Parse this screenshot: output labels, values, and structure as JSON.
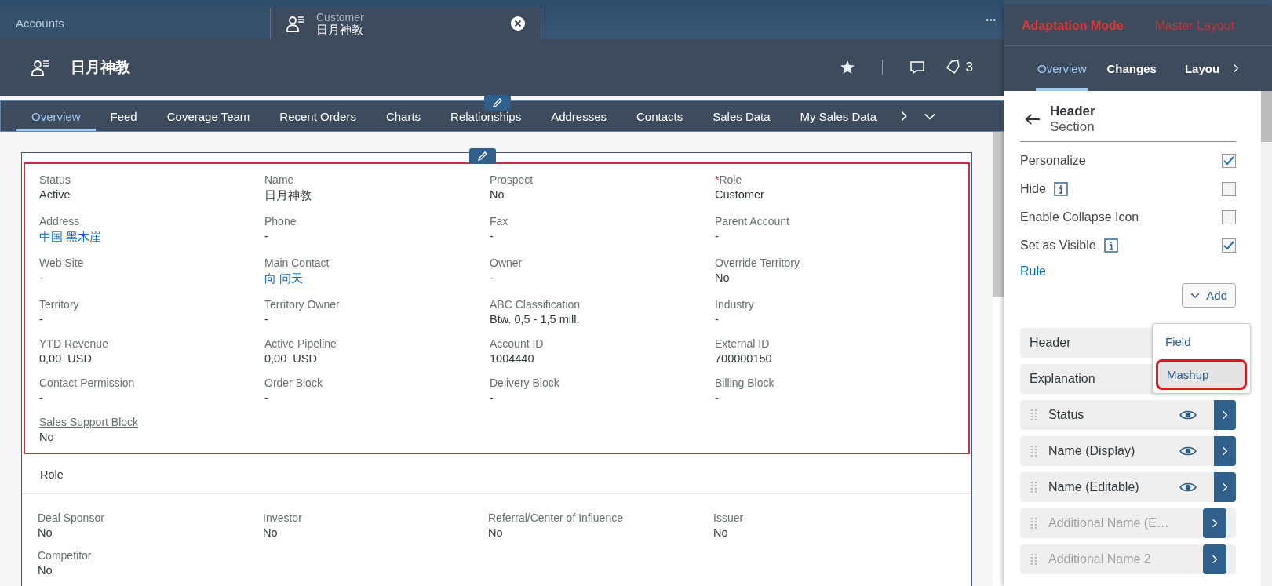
{
  "top_tabs": [
    {
      "label": "Accounts",
      "selected": false
    },
    {
      "title": "Customer",
      "label": "日月神教",
      "selected": true
    }
  ],
  "overflow": "•••",
  "header": {
    "title": "日月神教",
    "count": "3"
  },
  "nav_tabs": [
    {
      "label": "Overview",
      "selected": true
    },
    {
      "label": "Feed",
      "selected": false
    },
    {
      "label": "Coverage Team",
      "selected": false
    },
    {
      "label": "Recent Orders",
      "selected": false
    },
    {
      "label": "Charts",
      "selected": false
    },
    {
      "label": "Relationships",
      "selected": false
    },
    {
      "label": "Addresses",
      "selected": false
    },
    {
      "label": "Contacts",
      "selected": false
    },
    {
      "label": "Sales Data",
      "selected": false
    },
    {
      "label": "My Sales Data",
      "selected": false
    }
  ],
  "header_fields": [
    {
      "label": "Status",
      "underlined": false,
      "value": "Active",
      "link": false
    },
    {
      "label": "Name",
      "underlined": false,
      "value": "日月神教",
      "link": false
    },
    {
      "label": "Prospect",
      "underlined": false,
      "value": "No",
      "link": false
    },
    {
      "required_mark": "*",
      "label": "Role",
      "underlined": false,
      "value": "Customer",
      "link": false
    },
    {
      "label": "Address",
      "underlined": false,
      "value": "中国 黑木崖",
      "link": true
    },
    {
      "label": "Phone",
      "underlined": false,
      "value": "-",
      "link": false
    },
    {
      "label": "Fax",
      "underlined": false,
      "value": "-",
      "link": false
    },
    {
      "label": "Parent Account",
      "underlined": false,
      "value": "-",
      "link": false
    },
    {
      "label": "Web Site",
      "underlined": false,
      "value": "-",
      "link": false
    },
    {
      "label": "Main Contact",
      "underlined": false,
      "value": "向 问天",
      "link": true
    },
    {
      "label": "Owner",
      "underlined": false,
      "value": "-",
      "link": false
    },
    {
      "label": "Override Territory",
      "underlined": true,
      "value": "No",
      "link": false
    },
    {
      "label": "Territory",
      "underlined": false,
      "value": "-",
      "link": false
    },
    {
      "label": "Territory Owner",
      "underlined": false,
      "value": "-",
      "link": false
    },
    {
      "label": "ABC Classification",
      "underlined": false,
      "value": "Btw. 0,5 - 1,5 mill.",
      "link": false
    },
    {
      "label": "Industry",
      "underlined": false,
      "value": "-",
      "link": false
    },
    {
      "label": "YTD Revenue",
      "underlined": false,
      "value": "0,00  USD",
      "link": false
    },
    {
      "label": "Active Pipeline",
      "underlined": false,
      "value": "0,00  USD",
      "link": false
    },
    {
      "label": "Account ID",
      "underlined": false,
      "value": "1004440",
      "link": false
    },
    {
      "label": "External ID",
      "underlined": false,
      "value": "700000150",
      "link": false
    },
    {
      "label": "Contact Permission",
      "underlined": false,
      "value": "-",
      "link": false
    },
    {
      "label": "Order Block",
      "underlined": false,
      "value": "-",
      "link": false
    },
    {
      "label": "Delivery Block",
      "underlined": false,
      "value": "-",
      "link": false
    },
    {
      "label": "Billing Block",
      "underlined": false,
      "value": "-",
      "link": false
    },
    {
      "label": "Sales Support Block",
      "underlined": true,
      "value": "No",
      "link": false
    }
  ],
  "role_section": {
    "title": "Role",
    "fields": [
      {
        "label": "Deal Sponsor",
        "value": "No"
      },
      {
        "label": "Investor",
        "value": "No"
      },
      {
        "label": "Referral/Center of Influence",
        "value": "No"
      },
      {
        "label": "Issuer",
        "value": "No"
      },
      {
        "label": "Competitor",
        "value": "No"
      }
    ]
  },
  "panel": {
    "mode": "Adaptation Mode",
    "layout": "Master Layout",
    "tabs": [
      {
        "label": "Overview",
        "selected": true
      },
      {
        "label": "Changes",
        "selected": false
      },
      {
        "label": "Layou",
        "selected": false
      }
    ],
    "title": "Header",
    "subtitle": "Section",
    "options": [
      {
        "label": "Personalize",
        "info": false,
        "checked": true
      },
      {
        "label": "Hide",
        "info": true,
        "checked": false
      },
      {
        "label": "Enable Collapse Icon",
        "info": false,
        "checked": false
      },
      {
        "label": "Set as Visible",
        "info": true,
        "checked": true
      }
    ],
    "rule_link": "Rule",
    "add_button": "Add",
    "menu": [
      {
        "label": "Field",
        "highlighted": false
      },
      {
        "label": "Mashup",
        "highlighted": true
      }
    ],
    "rows": [
      {
        "kind": "section",
        "label": "Header"
      },
      {
        "kind": "section",
        "label": "Explanation"
      },
      {
        "kind": "field",
        "label": "Status",
        "visible": true,
        "disabled": false
      },
      {
        "kind": "field",
        "label": "Name (Display)",
        "visible": true,
        "disabled": false
      },
      {
        "kind": "field",
        "label": "Name (Editable)",
        "visible": true,
        "disabled": false
      },
      {
        "kind": "field",
        "label": "Additional Name (E…",
        "visible": false,
        "disabled": true
      },
      {
        "kind": "field",
        "label": "Additional Name 2",
        "visible": false,
        "disabled": true
      }
    ]
  }
}
